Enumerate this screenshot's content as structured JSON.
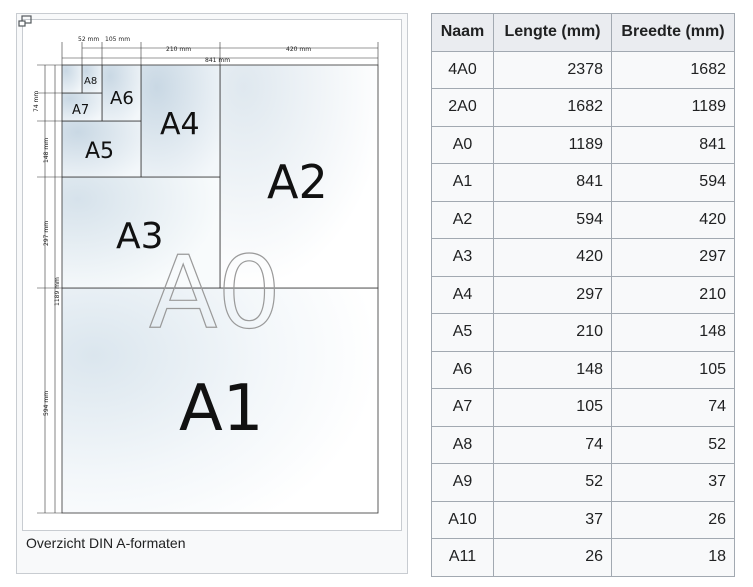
{
  "figure": {
    "caption": "Overzicht DIN A-formaten",
    "paper_labels": {
      "A0": "A0",
      "A1": "A1",
      "A2": "A2",
      "A3": "A3",
      "A4": "A4",
      "A5": "A5",
      "A6": "A6",
      "A7": "A7",
      "A8": "A8"
    },
    "dimension_labels": {
      "w52": "52 mm",
      "w105": "105 mm",
      "w210": "210 mm",
      "w420": "420 mm",
      "w841": "841 mm",
      "h74": "74 mm",
      "h148": "148 mm",
      "h297": "297 mm",
      "h1189": "1189 mm",
      "h594": "594 mm"
    },
    "enlarge_icon": "magnify-icon"
  },
  "table": {
    "headers": [
      "Naam",
      "Lengte (mm)",
      "Breedte (mm)"
    ],
    "rows": [
      [
        "4A0",
        "2378",
        "1682"
      ],
      [
        "2A0",
        "1682",
        "1189"
      ],
      [
        "A0",
        "1189",
        "841"
      ],
      [
        "A1",
        "841",
        "594"
      ],
      [
        "A2",
        "594",
        "420"
      ],
      [
        "A3",
        "420",
        "297"
      ],
      [
        "A4",
        "297",
        "210"
      ],
      [
        "A5",
        "210",
        "148"
      ],
      [
        "A6",
        "148",
        "105"
      ],
      [
        "A7",
        "105",
        "74"
      ],
      [
        "A8",
        "74",
        "52"
      ],
      [
        "A9",
        "52",
        "37"
      ],
      [
        "A10",
        "37",
        "26"
      ],
      [
        "A11",
        "26",
        "18"
      ]
    ]
  }
}
